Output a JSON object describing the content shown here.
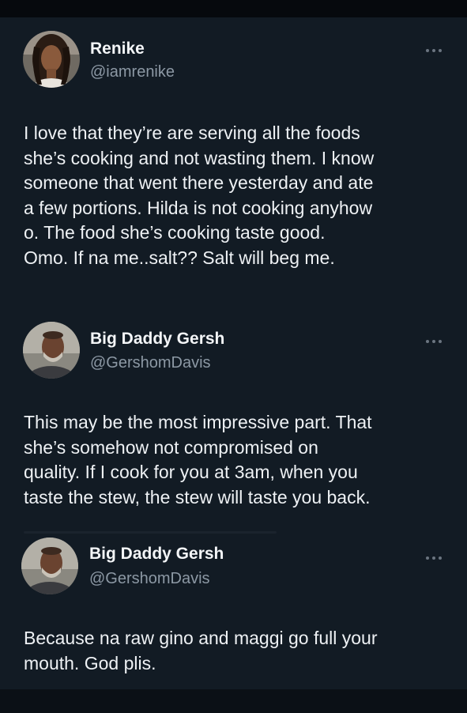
{
  "tweets": [
    {
      "name": "Renike",
      "handle": "@iamrenike",
      "avatar_icon": "profile-photo-woman",
      "more_icon": "ellipsis",
      "lines": [
        "I love that they’re are serving all the foods",
        "she’s cooking and not wasting them. I know",
        "someone that went there yesterday and ate",
        "a few portions. Hilda is not cooking anyhow",
        "o. The food she’s cooking taste good.",
        "Omo. If na me..salt?? Salt will beg me."
      ]
    },
    {
      "name": "Big Daddy Gersh",
      "handle": "@GershomDavis",
      "avatar_icon": "profile-photo-man",
      "more_icon": "ellipsis",
      "lines": [
        "This may be the most impressive part. That",
        "she’s somehow not compromised on",
        "quality. If I cook for you at 3am, when you",
        "taste the stew, the stew will taste you back."
      ]
    },
    {
      "name": "Big Daddy Gersh",
      "handle": "@GershomDavis",
      "avatar_icon": "profile-photo-man",
      "more_icon": "ellipsis",
      "lines": [
        "Because na raw gino and maggi go full your",
        "mouth. God plis."
      ]
    }
  ],
  "colors": {
    "background": "#121b24",
    "text": "#eef1f4",
    "secondary_text": "#8c98a4"
  }
}
